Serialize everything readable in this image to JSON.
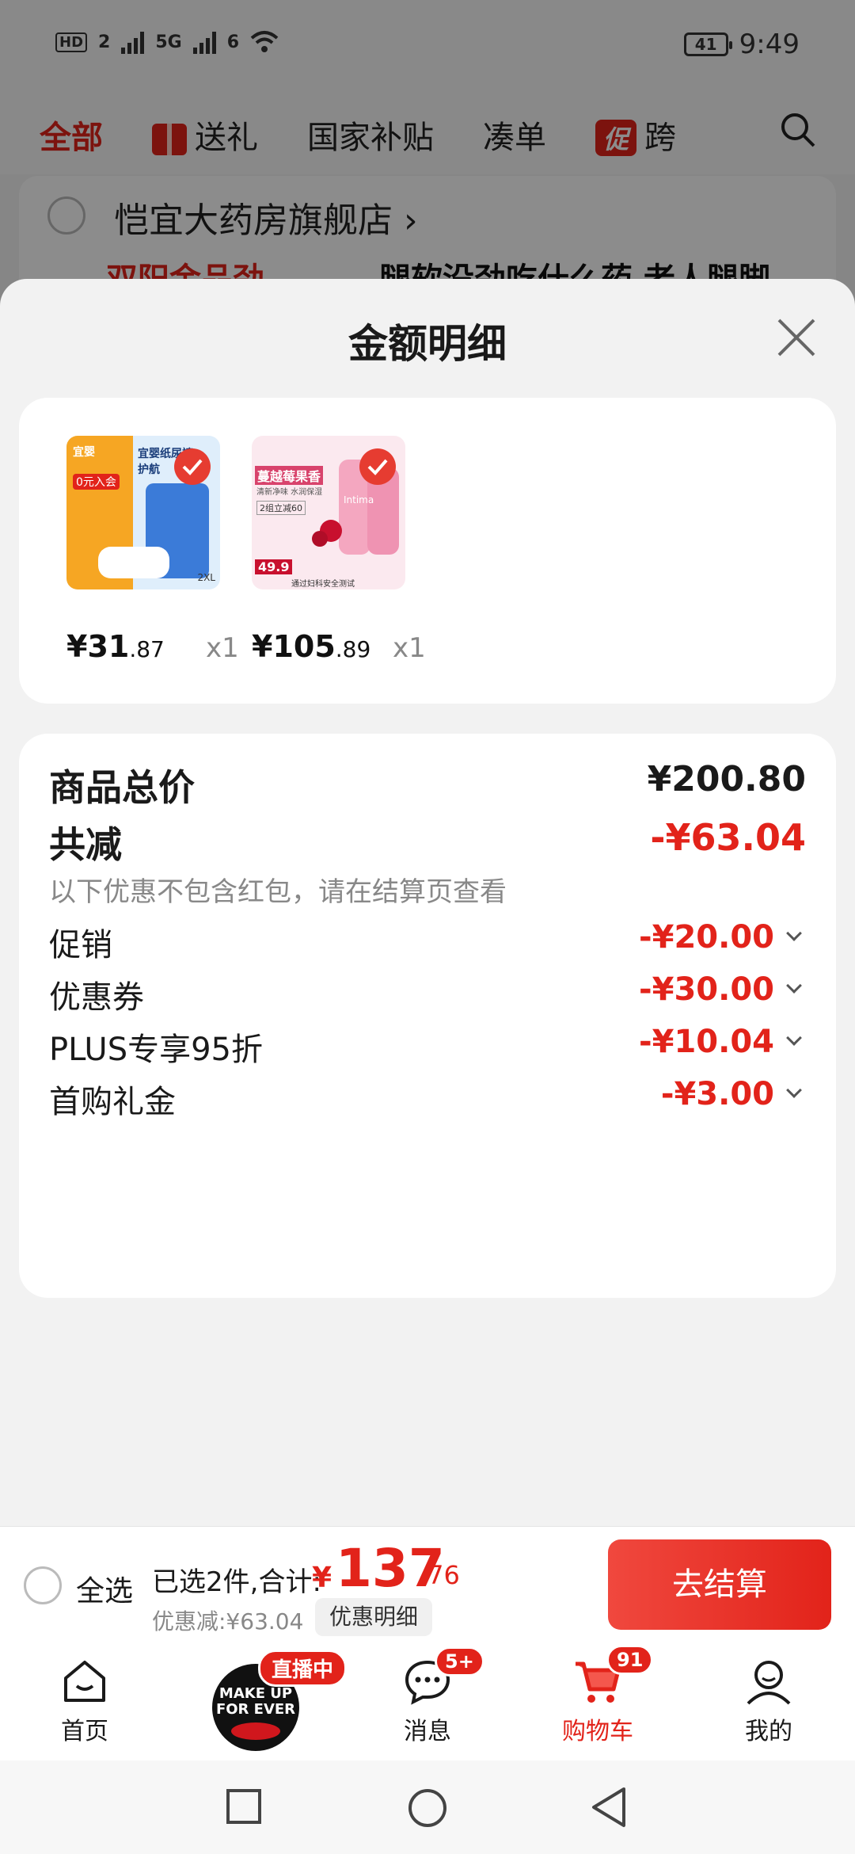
{
  "status_bar": {
    "left_badges": [
      "HD",
      "2",
      "5G",
      "6"
    ],
    "battery": "41",
    "time": "9:49"
  },
  "top_tabs": {
    "items": [
      "全部",
      "送礼",
      "国家补贴",
      "凑单",
      "跨"
    ],
    "promo_tag": "促"
  },
  "store": {
    "name": "恺宜大药房旗舰店 ›",
    "promo": "双阳金品劲",
    "desc": "腿软没劲吃什么药 老人腿脚"
  },
  "sheet": {
    "title": "金额明细",
    "products": [
      {
        "price_int": "¥31",
        "price_dec": ".87",
        "qty": "x1",
        "img_lines": [
          "宜婴",
          "0元入会",
          "宜婴纸尿裤护航",
          "2XL"
        ]
      },
      {
        "price_int": "¥105",
        "price_dec": ".89",
        "qty": "x1",
        "img_lines": [
          "蔓越莓果香",
          "清新净味 水润保湿",
          "2组立减60",
          "Intima",
          "49.9",
          "通过妇科安全测试"
        ]
      }
    ],
    "summary": {
      "total_label": "商品总价",
      "total_value": "¥200.80",
      "reduce_label": "共减",
      "reduce_value": "-¥63.04",
      "note": "以下优惠不包含红包，请在结算页查看",
      "discounts": [
        {
          "label": "促销",
          "value": "-¥20.00"
        },
        {
          "label": "优惠券",
          "value": "-¥30.00"
        },
        {
          "label": "PLUS专享95折",
          "value": "-¥10.04"
        },
        {
          "label": "首购礼金",
          "value": "-¥3.00"
        }
      ]
    }
  },
  "checkout": {
    "select_all": "全选",
    "selected_text": "已选2件,合计:",
    "yen": "¥",
    "total_int": "137",
    "total_dec": ".76",
    "saved_text": "优惠减:¥63.04",
    "detail_button": "优惠明细",
    "pay_button": "去结算"
  },
  "bottom_nav": {
    "items": [
      "首页",
      "消息",
      "购物车",
      "我的"
    ],
    "live_badge": "直播中",
    "live_logo": "MAKE UP FOR EVER",
    "msg_badge": "5+",
    "cart_badge": "91"
  },
  "colors": {
    "accent": "#e2231a",
    "background": "#f2f2f2"
  }
}
